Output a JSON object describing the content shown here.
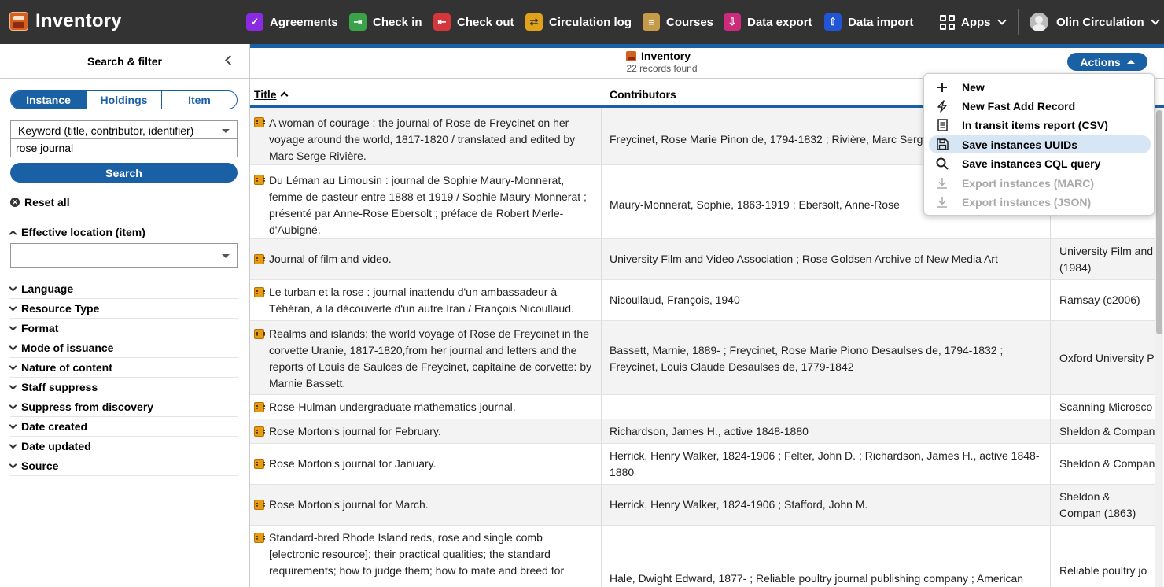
{
  "app": {
    "title": "Inventory"
  },
  "nav": {
    "items": [
      {
        "label": "Agreements",
        "icon": "agreements-icon",
        "color": "#8a2be2"
      },
      {
        "label": "Check in",
        "icon": "check-in-icon",
        "color": "#3aa34a"
      },
      {
        "label": "Check out",
        "icon": "check-out-icon",
        "color": "#d3363b"
      },
      {
        "label": "Circulation log",
        "icon": "circulation-log-icon",
        "color": "#e0a21b"
      },
      {
        "label": "Courses",
        "icon": "courses-icon",
        "color": "#c79a4a"
      },
      {
        "label": "Data export",
        "icon": "data-export-icon",
        "color": "#cc2a7a"
      },
      {
        "label": "Data import",
        "icon": "data-import-icon",
        "color": "#2255d6"
      }
    ],
    "apps_label": "Apps",
    "user_label": "Olin Circulation"
  },
  "sidebar": {
    "title": "Search & filter",
    "segments": [
      "Instance",
      "Holdings",
      "Item"
    ],
    "active_segment": "Instance",
    "search_option": "Keyword (title, contributor, identifier)",
    "query": "rose journal",
    "search_label": "Search",
    "reset_label": "Reset all",
    "open_facet": "Effective location (item)",
    "facets": [
      "Language",
      "Resource Type",
      "Format",
      "Mode of issuance",
      "Nature of content",
      "Staff suppress",
      "Suppress from discovery",
      "Date created",
      "Date updated",
      "Source"
    ]
  },
  "results": {
    "title": "Inventory",
    "count_label": "22 records found",
    "actions_label": "Actions",
    "columns": [
      "Title",
      "Contributors"
    ],
    "rows": [
      {
        "title": "A woman of courage : the journal of Rose de Freycinet on her voyage around the world, 1817-1820 / translated and edited by Marc Serge Rivière.",
        "contributors": "Freycinet, Rose Marie Pinon de, 1794-1832 ; Rivière, Marc Serge",
        "publisher": ""
      },
      {
        "title": "Du Léman au Limousin : journal de Sophie Maury-Monnerat, femme de pasteur entre 1888 et 1919 / Sophie Maury-Monnerat ; présenté par Anne-Rose Ebersolt ; préface de Robert Merle-d'Aubigné.",
        "contributors": "Maury-Monnerat, Sophie, 1863-1919 ; Ebersolt, Anne-Rose",
        "publisher": ""
      },
      {
        "title": "Journal of film and video.",
        "contributors": "University Film and Video Association ; Rose Goldsen Archive of New Media Art",
        "publisher": "University Film and (1984)"
      },
      {
        "title": "Le turban et la rose : journal inattendu d'un ambassadeur à Téhéran, à la découverte d'un autre Iran / François Nicoullaud.",
        "contributors": "Nicoullaud, François, 1940-",
        "publisher": "Ramsay (c2006)"
      },
      {
        "title": "Realms and islands: the world voyage of Rose de Freycinet in the corvette Uranie, 1817-1820,from her journal and letters and the reports of Louis de Saulces de Freycinet, capitaine de corvette: by Marnie Bassett.",
        "contributors": "Bassett, Marnie, 1889- ; Freycinet, Rose Marie Piono Desaulses de, 1794-1832 ; Freycinet, Louis Claude Desaulses de, 1779-1842",
        "publisher": "Oxford University P"
      },
      {
        "title": "Rose-Hulman undergraduate mathematics journal.",
        "contributors": "",
        "publisher": "Scanning Microsco"
      },
      {
        "title": "Rose Morton's journal for February.",
        "contributors": "Richardson, James H., active 1848-1880",
        "publisher": "Sheldon & Compan"
      },
      {
        "title": "Rose Morton's journal for January.",
        "contributors": "Herrick, Henry Walker, 1824-1906 ; Felter, John D. ; Richardson, James H., active 1848-1880",
        "publisher": "Sheldon & Compan"
      },
      {
        "title": "Rose Morton's journal for March.",
        "contributors": "Herrick, Henry Walker, 1824-1906 ; Stafford, John M.",
        "publisher": "Sheldon & Compan (1863)"
      },
      {
        "title": "Standard-bred Rhode Island reds, rose and single comb [electronic resource]; their practical qualities; the standard requirements; how to judge them; how to mate and breed for",
        "contributors": "Hale, Dwight Edward, 1877- ; Reliable poultry journal publishing company ; American",
        "publisher": "Reliable poultry jo"
      }
    ]
  },
  "actions_menu": [
    {
      "label": "New",
      "icon": "plus-icon",
      "disabled": false,
      "highlighted": false
    },
    {
      "label": "New Fast Add Record",
      "icon": "lightning-icon",
      "disabled": false,
      "highlighted": false
    },
    {
      "label": "In transit items report (CSV)",
      "icon": "report-icon",
      "disabled": false,
      "highlighted": false
    },
    {
      "label": "Save instances UUIDs",
      "icon": "save-icon",
      "disabled": false,
      "highlighted": true
    },
    {
      "label": "Save instances CQL query",
      "icon": "search-icon",
      "disabled": false,
      "highlighted": false
    },
    {
      "label": "Export instances (MARC)",
      "icon": "download-icon",
      "disabled": true,
      "highlighted": false
    },
    {
      "label": "Export instances (JSON)",
      "icon": "download-icon",
      "disabled": true,
      "highlighted": false
    }
  ],
  "colors": {
    "accent": "#1960a4",
    "topbar": "#333333",
    "highlight": "#d6e6f5"
  }
}
